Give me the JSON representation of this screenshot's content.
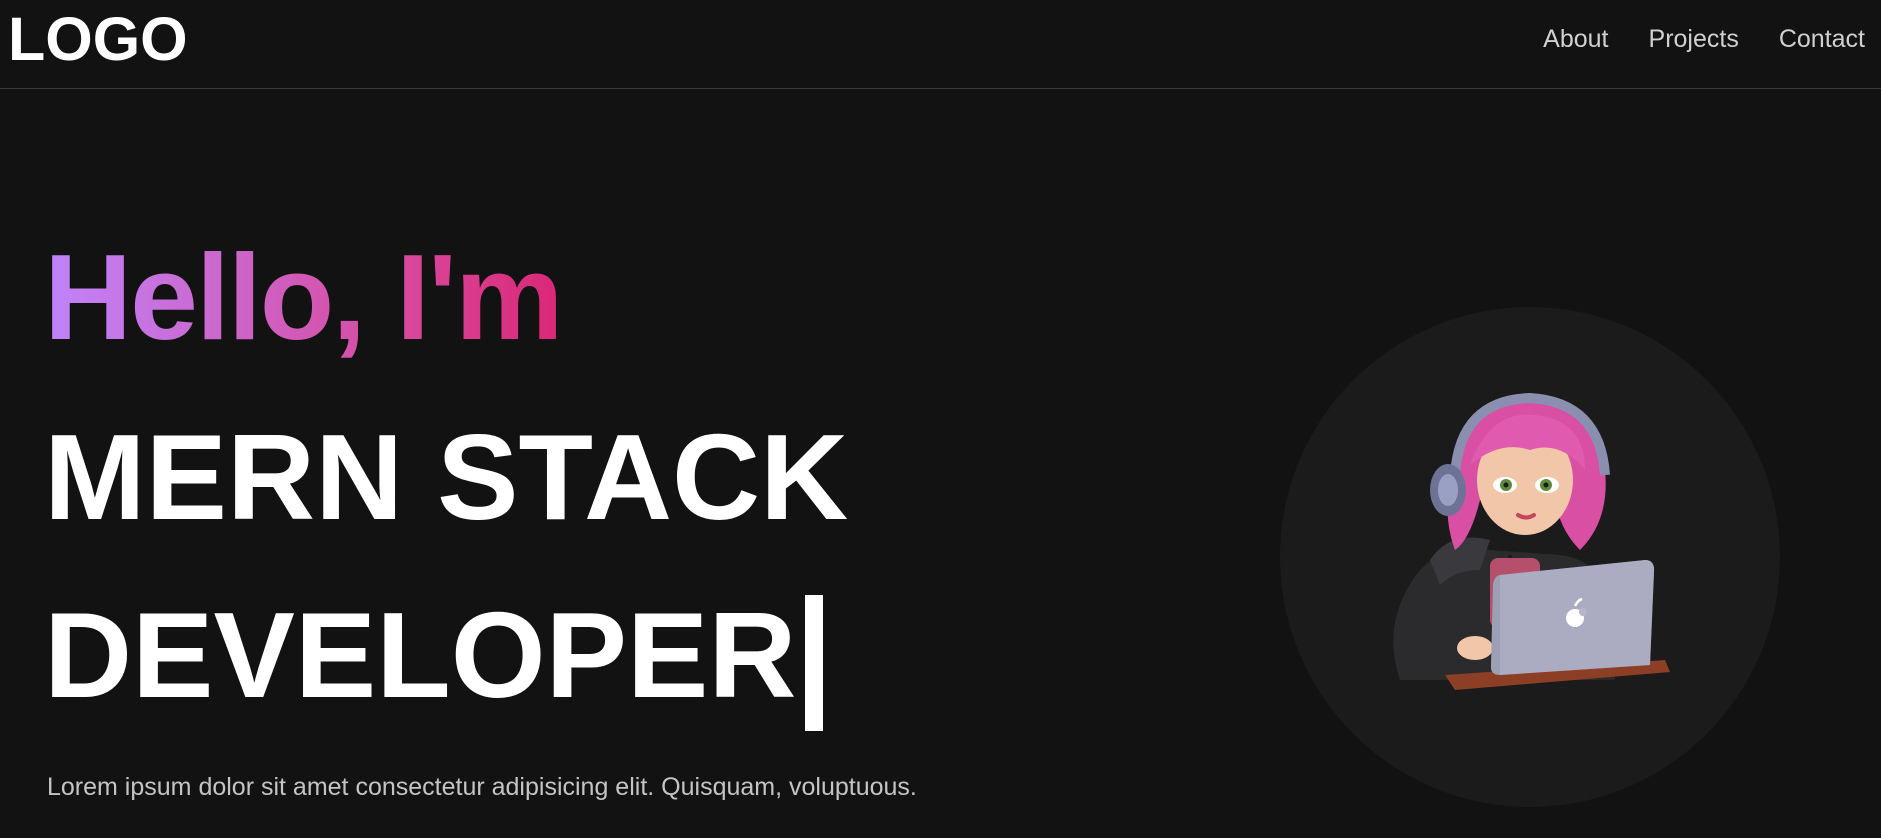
{
  "navbar": {
    "logo": "LOGO",
    "links": [
      "About",
      "Projects",
      "Contact"
    ]
  },
  "hero": {
    "greeting": "Hello, I'm",
    "title_line1": "MERN STACK",
    "title_line2": "DEVELOPER",
    "description": "Lorem ipsum dolor sit amet consectetur adipisicing elit. Quisquam, voluptuous."
  },
  "colors": {
    "background": "#121212",
    "gradient_start": "#c084fc",
    "gradient_end": "#db2777",
    "avatar_circle": "#1b1b1b"
  },
  "icons": {
    "avatar": "developer-girl-with-laptop-illustration"
  }
}
